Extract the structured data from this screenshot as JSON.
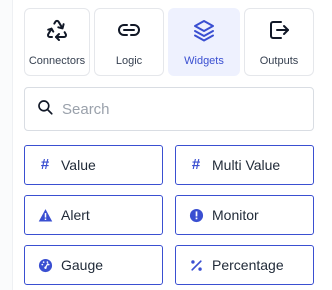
{
  "tabs": [
    {
      "label": "Connectors",
      "icon": "recycle-icon",
      "active": false
    },
    {
      "label": "Logic",
      "icon": "link-icon",
      "active": false
    },
    {
      "label": "Widgets",
      "icon": "layers-icon",
      "active": true
    },
    {
      "label": "Outputs",
      "icon": "logout-icon",
      "active": false
    }
  ],
  "search": {
    "placeholder": "Search",
    "value": ""
  },
  "widgets": [
    {
      "label": "Value",
      "icon": "hash-icon"
    },
    {
      "label": "Multi Value",
      "icon": "hash-icon"
    },
    {
      "label": "Alert",
      "icon": "warning-triangle-icon"
    },
    {
      "label": "Monitor",
      "icon": "alert-circle-icon"
    },
    {
      "label": "Gauge",
      "icon": "gauge-icon"
    },
    {
      "label": "Percentage",
      "icon": "percent-icon"
    }
  ],
  "colors": {
    "accent": "#3a4fd1",
    "active_tab_bg": "#eef1fe",
    "border": "#e5e7eb"
  }
}
